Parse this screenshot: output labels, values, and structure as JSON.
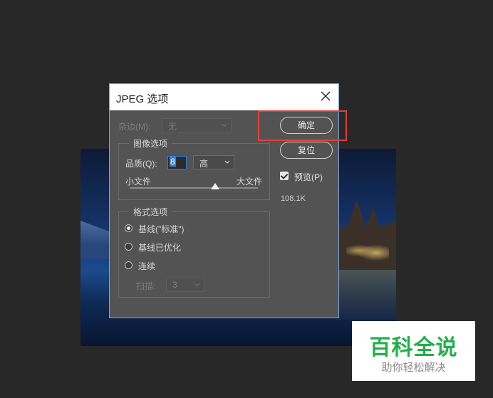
{
  "dialog": {
    "title": "JPEG 选项",
    "matte": {
      "label": "杂边(M):",
      "value": "无"
    },
    "image_options": {
      "group_title": "图像选项",
      "quality_label": "品质(Q):",
      "quality_value": "8",
      "quality_preset": "高",
      "small_file": "小文件",
      "large_file": "大文件",
      "slider_level_of_12": 8
    },
    "format_options": {
      "group_title": "格式选项",
      "baseline_standard": "基线(\"标准\")",
      "baseline_optimized": "基线已优化",
      "progressive": "连续",
      "scans_label": "扫描:",
      "scans_value": "3",
      "selected": "baseline_standard"
    },
    "buttons": {
      "ok": "确定",
      "reset": "复位"
    },
    "preview": {
      "label": "预览(P)",
      "checked": true
    },
    "file_size": "108.1K",
    "highlight_color": "#e0403a"
  },
  "watermark": {
    "main": "百科全说",
    "sub": "助你轻松解决"
  }
}
